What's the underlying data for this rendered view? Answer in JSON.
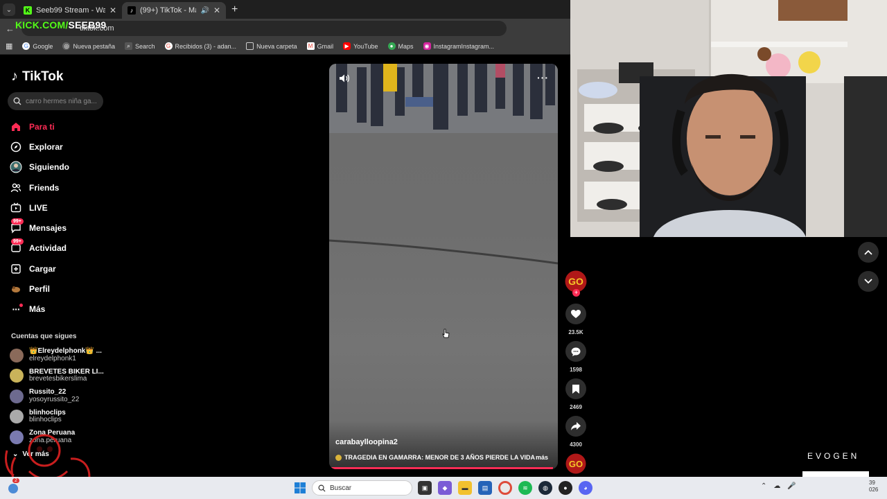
{
  "browser": {
    "tabs": [
      {
        "title": "Seeb99 Stream - Watch Live on",
        "active": false
      },
      {
        "title": "(99+) TikTok - Make Your Da",
        "active": true
      }
    ],
    "url": "tiktok.com",
    "bookmarks": [
      "Google",
      "Nueva pestaña",
      "Search",
      "Recibidos (3) - adan...",
      "Nueva carpeta",
      "Gmail",
      "YouTube",
      "Maps",
      "InstagramInstagram..."
    ]
  },
  "overlay": {
    "kick_prefix": "KICK.COM/",
    "kick_channel": "SEEB99"
  },
  "tiktok": {
    "logo": "TikTok",
    "search_placeholder": "carro hermes niña ga...",
    "nav": [
      {
        "label": "Para ti",
        "icon": "home-icon",
        "active": true
      },
      {
        "label": "Explorar",
        "icon": "compass-icon"
      },
      {
        "label": "Siguiendo",
        "icon": "following-avatar-icon"
      },
      {
        "label": "Friends",
        "icon": "friends-icon"
      },
      {
        "label": "LIVE",
        "icon": "live-tv-icon"
      },
      {
        "label": "Mensajes",
        "icon": "messages-icon",
        "badge": "99+"
      },
      {
        "label": "Actividad",
        "icon": "activity-icon",
        "badge": "99+"
      },
      {
        "label": "Cargar",
        "icon": "upload-icon"
      },
      {
        "label": "Perfil",
        "icon": "profile-icon"
      },
      {
        "label": "Más",
        "icon": "more-icon"
      }
    ],
    "following_title": "Cuentas que sigues",
    "following": [
      {
        "name": "👑Elreydelphonk👑 ...",
        "handle": "elreydelphonk1",
        "color": "#8a6a5a"
      },
      {
        "name": "BREVETES BIKER LI...",
        "handle": "brevetesbikerslima",
        "color": "#c9b35a"
      },
      {
        "name": "Russito_22",
        "handle": "yosoyrussito_22",
        "color": "#6d6a8f"
      },
      {
        "name": "blinhoclips",
        "handle": "blinhoclips",
        "color": "#aaaaaa"
      },
      {
        "name": "Zona Peruana",
        "handle": "zona.peruana",
        "color": "#7a7ab0"
      }
    ],
    "see_more": "Ver más",
    "video": {
      "author": "carabaylloopina2",
      "description": "TRAGEDIA EN GAMARRA: MENOR DE 3 AÑOS PIERDE LA VIDA",
      "more": "más",
      "progress": 0.98
    },
    "actions": {
      "likes": "23.5K",
      "comments": "1598",
      "saves": "2469",
      "shares": "4300"
    }
  },
  "branding": {
    "evogen_top": "EVOGEN",
    "evogen_box": "EVOGEN"
  },
  "taskbar": {
    "search_label": "Buscar",
    "notification_count": "2",
    "clock_time": "39",
    "clock_date": "026"
  },
  "colors": {
    "accent": "#fe2c55",
    "kick_green": "#53fc18"
  }
}
